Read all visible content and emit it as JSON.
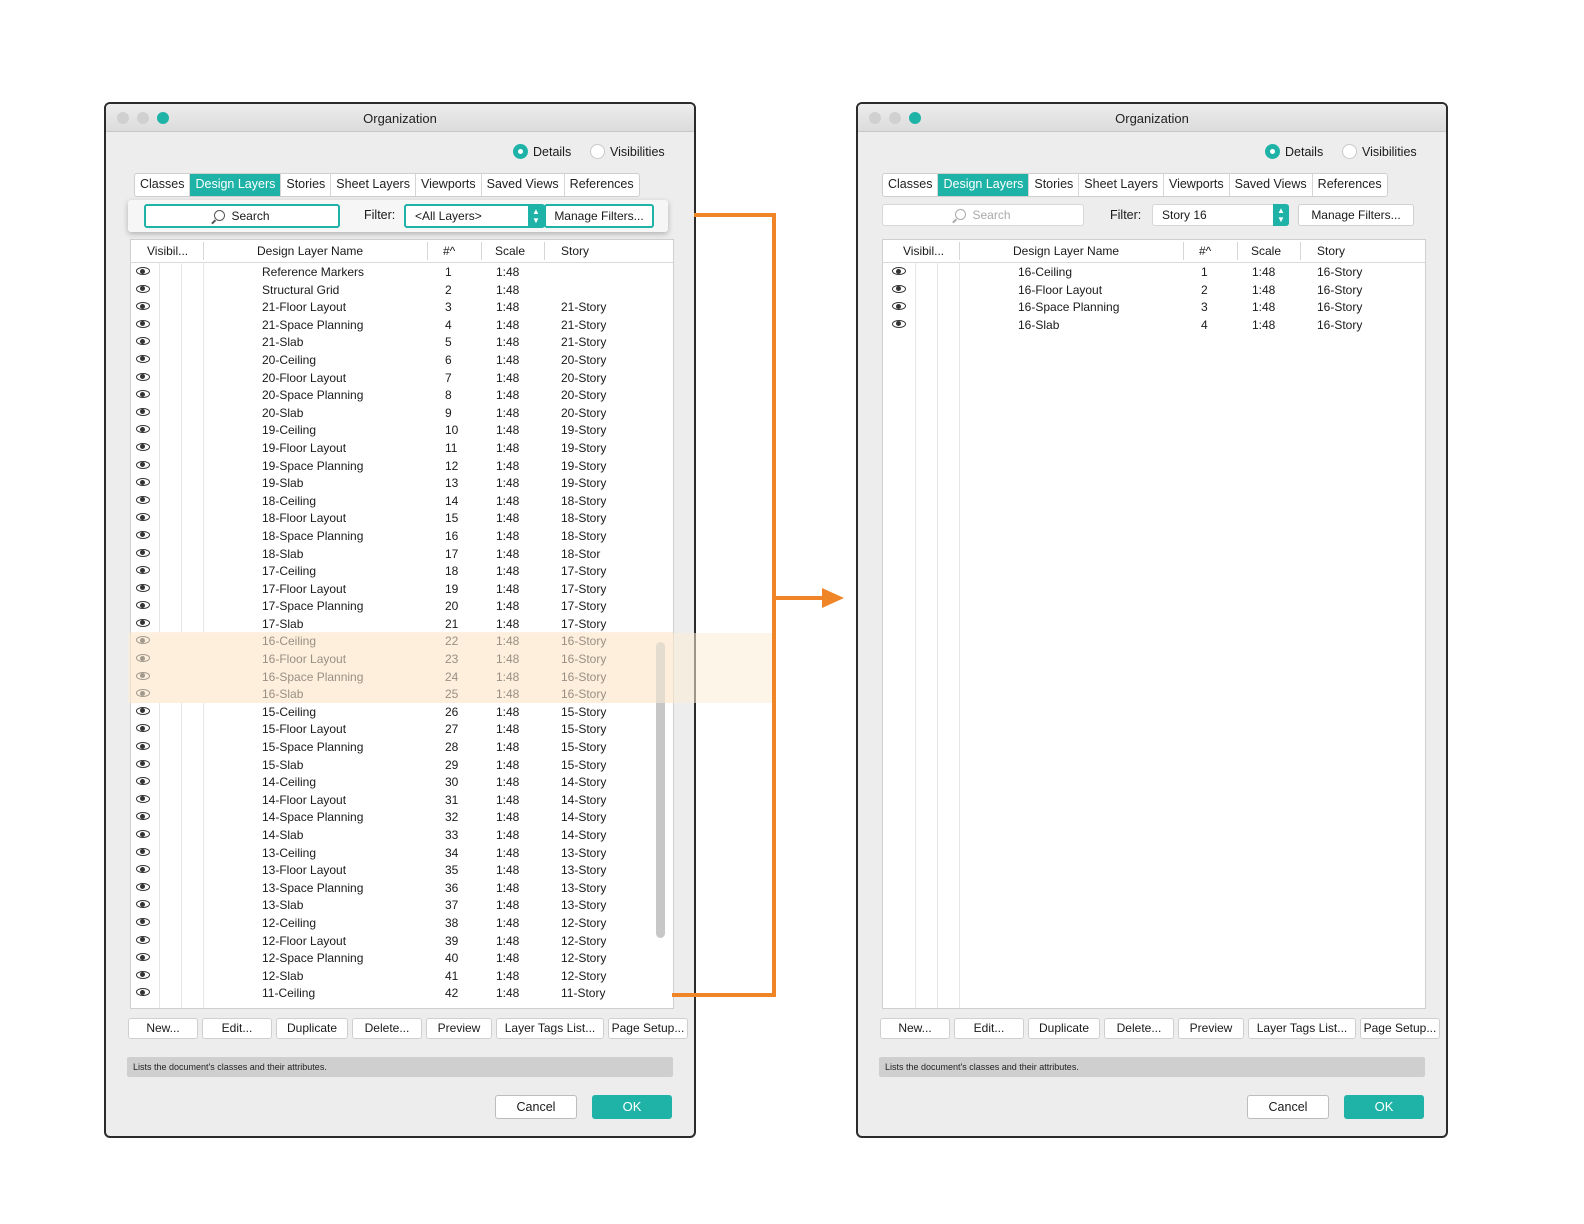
{
  "accent_color": "#1fb3a8",
  "connector_color": "#f08527",
  "window_title": "Organization",
  "radio": {
    "details": "Details",
    "visibilities": "Visibilities",
    "selected": "details"
  },
  "tabs": [
    "Classes",
    "Design Layers",
    "Stories",
    "Sheet Layers",
    "Viewports",
    "Saved Views",
    "References"
  ],
  "active_tab": "Design Layers",
  "search_placeholder": "Search",
  "filter_label": "Filter:",
  "manage_filters": "Manage Filters...",
  "columns": {
    "visibility": "Visibil...",
    "name": "Design Layer Name",
    "number": "#^",
    "scale": "Scale",
    "story": "Story"
  },
  "buttons": [
    "New...",
    "Edit...",
    "Duplicate",
    "Delete...",
    "Preview",
    "Layer Tags List...",
    "Page Setup..."
  ],
  "status_text": "Lists the document's classes and their attributes.",
  "cancel": "Cancel",
  "ok": "OK",
  "left_panel": {
    "filter_value": "<All Layers>",
    "highlighted_rows": [
      22,
      23,
      24,
      25
    ],
    "rows": [
      {
        "name": "Reference Markers",
        "num": "1",
        "scale": "1:48",
        "story": ""
      },
      {
        "name": "Structural Grid",
        "num": "2",
        "scale": "1:48",
        "story": ""
      },
      {
        "name": "21-Floor Layout",
        "num": "3",
        "scale": "1:48",
        "story": "21-Story"
      },
      {
        "name": "21-Space Planning",
        "num": "4",
        "scale": "1:48",
        "story": "21-Story"
      },
      {
        "name": "21-Slab",
        "num": "5",
        "scale": "1:48",
        "story": "21-Story"
      },
      {
        "name": "20-Ceiling",
        "num": "6",
        "scale": "1:48",
        "story": "20-Story"
      },
      {
        "name": "20-Floor Layout",
        "num": "7",
        "scale": "1:48",
        "story": "20-Story"
      },
      {
        "name": "20-Space Planning",
        "num": "8",
        "scale": "1:48",
        "story": "20-Story"
      },
      {
        "name": "20-Slab",
        "num": "9",
        "scale": "1:48",
        "story": "20-Story"
      },
      {
        "name": "19-Ceiling",
        "num": "10",
        "scale": "1:48",
        "story": "19-Story"
      },
      {
        "name": "19-Floor Layout",
        "num": "11",
        "scale": "1:48",
        "story": "19-Story"
      },
      {
        "name": "19-Space Planning",
        "num": "12",
        "scale": "1:48",
        "story": "19-Story"
      },
      {
        "name": "19-Slab",
        "num": "13",
        "scale": "1:48",
        "story": "19-Story"
      },
      {
        "name": "18-Ceiling",
        "num": "14",
        "scale": "1:48",
        "story": "18-Story"
      },
      {
        "name": "18-Floor Layout",
        "num": "15",
        "scale": "1:48",
        "story": "18-Story"
      },
      {
        "name": "18-Space Planning",
        "num": "16",
        "scale": "1:48",
        "story": "18-Story"
      },
      {
        "name": "18-Slab",
        "num": "17",
        "scale": "1:48",
        "story": "18-Stor"
      },
      {
        "name": "17-Ceiling",
        "num": "18",
        "scale": "1:48",
        "story": "17-Story"
      },
      {
        "name": "17-Floor Layout",
        "num": "19",
        "scale": "1:48",
        "story": "17-Story"
      },
      {
        "name": "17-Space Planning",
        "num": "20",
        "scale": "1:48",
        "story": "17-Story"
      },
      {
        "name": "17-Slab",
        "num": "21",
        "scale": "1:48",
        "story": "17-Story"
      },
      {
        "name": "16-Ceiling",
        "num": "22",
        "scale": "1:48",
        "story": "16-Story"
      },
      {
        "name": "16-Floor Layout",
        "num": "23",
        "scale": "1:48",
        "story": "16-Story"
      },
      {
        "name": "16-Space Planning",
        "num": "24",
        "scale": "1:48",
        "story": "16-Story"
      },
      {
        "name": "16-Slab",
        "num": "25",
        "scale": "1:48",
        "story": "16-Story"
      },
      {
        "name": "15-Ceiling",
        "num": "26",
        "scale": "1:48",
        "story": "15-Story"
      },
      {
        "name": "15-Floor Layout",
        "num": "27",
        "scale": "1:48",
        "story": "15-Story"
      },
      {
        "name": "15-Space Planning",
        "num": "28",
        "scale": "1:48",
        "story": "15-Story"
      },
      {
        "name": "15-Slab",
        "num": "29",
        "scale": "1:48",
        "story": "15-Story"
      },
      {
        "name": "14-Ceiling",
        "num": "30",
        "scale": "1:48",
        "story": "14-Story"
      },
      {
        "name": "14-Floor Layout",
        "num": "31",
        "scale": "1:48",
        "story": "14-Story"
      },
      {
        "name": "14-Space Planning",
        "num": "32",
        "scale": "1:48",
        "story": "14-Story"
      },
      {
        "name": "14-Slab",
        "num": "33",
        "scale": "1:48",
        "story": "14-Story"
      },
      {
        "name": "13-Ceiling",
        "num": "34",
        "scale": "1:48",
        "story": "13-Story"
      },
      {
        "name": "13-Floor Layout",
        "num": "35",
        "scale": "1:48",
        "story": "13-Story"
      },
      {
        "name": "13-Space Planning",
        "num": "36",
        "scale": "1:48",
        "story": "13-Story"
      },
      {
        "name": "13-Slab",
        "num": "37",
        "scale": "1:48",
        "story": "13-Story"
      },
      {
        "name": "12-Ceiling",
        "num": "38",
        "scale": "1:48",
        "story": "12-Story"
      },
      {
        "name": "12-Floor Layout",
        "num": "39",
        "scale": "1:48",
        "story": "12-Story"
      },
      {
        "name": "12-Space Planning",
        "num": "40",
        "scale": "1:48",
        "story": "12-Story"
      },
      {
        "name": "12-Slab",
        "num": "41",
        "scale": "1:48",
        "story": "12-Story"
      },
      {
        "name": "11-Ceiling",
        "num": "42",
        "scale": "1:48",
        "story": "11-Story"
      }
    ]
  },
  "right_panel": {
    "filter_value": "Story 16",
    "rows": [
      {
        "name": "16-Ceiling",
        "num": "1",
        "scale": "1:48",
        "story": "16-Story"
      },
      {
        "name": "16-Floor Layout",
        "num": "2",
        "scale": "1:48",
        "story": "16-Story"
      },
      {
        "name": "16-Space Planning",
        "num": "3",
        "scale": "1:48",
        "story": "16-Story"
      },
      {
        "name": "16-Slab",
        "num": "4",
        "scale": "1:48",
        "story": "16-Story"
      }
    ]
  }
}
